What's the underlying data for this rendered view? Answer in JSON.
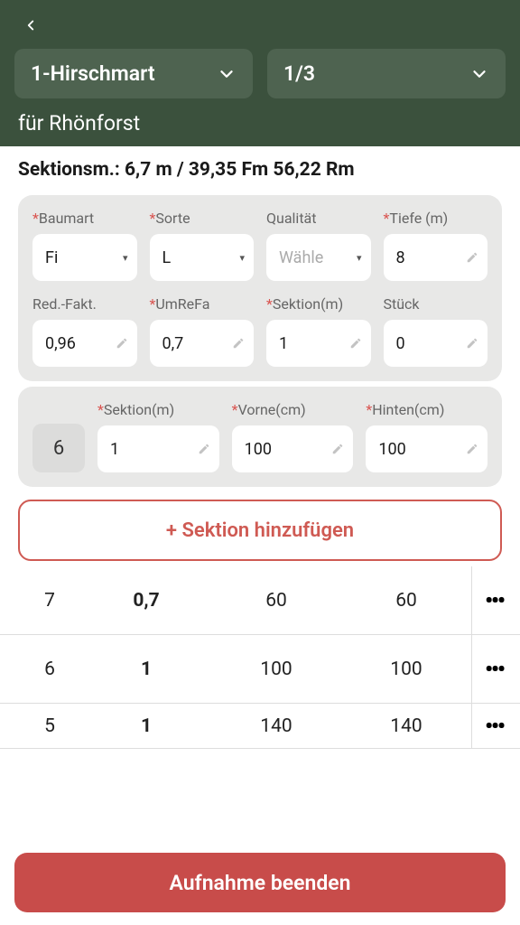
{
  "header": {
    "dropdown1": "1-Hirschmart",
    "dropdown2": "1/3",
    "subtitle": "für Rhönforst"
  },
  "summary": "Sektionsm.: 6,7 m / 39,35 Fm 56,22 Rm",
  "form": {
    "labels": {
      "baumart": "Baumart",
      "sorte": "Sorte",
      "qualitaet": "Qualität",
      "tiefe": "Tiefe (m)",
      "redfakt": "Red.-Fakt.",
      "umrefa": "UmReFa",
      "sektion_m": "Sektion(m)",
      "stueck": "Stück"
    },
    "values": {
      "baumart": "Fi",
      "sorte": "L",
      "qualitaet_placeholder": "Wähle",
      "tiefe": "8",
      "redfakt": "0,96",
      "umrefa": "0,7",
      "sektion_m": "1",
      "stueck": "0"
    }
  },
  "section_input": {
    "index": "6",
    "labels": {
      "sektion": "Sektion(m)",
      "vorne": "Vorne(cm)",
      "hinten": "Hinten(cm)"
    },
    "values": {
      "sektion": "1",
      "vorne": "100",
      "hinten": "100"
    }
  },
  "add_button": "+ Sektion hinzufügen",
  "rows": [
    {
      "idx": "7",
      "a": "0,7",
      "b": "60",
      "c": "60"
    },
    {
      "idx": "6",
      "a": "1",
      "b": "100",
      "c": "100"
    },
    {
      "idx": "5",
      "a": "1",
      "b": "140",
      "c": "140"
    }
  ],
  "footer": "Aufnahme beenden"
}
